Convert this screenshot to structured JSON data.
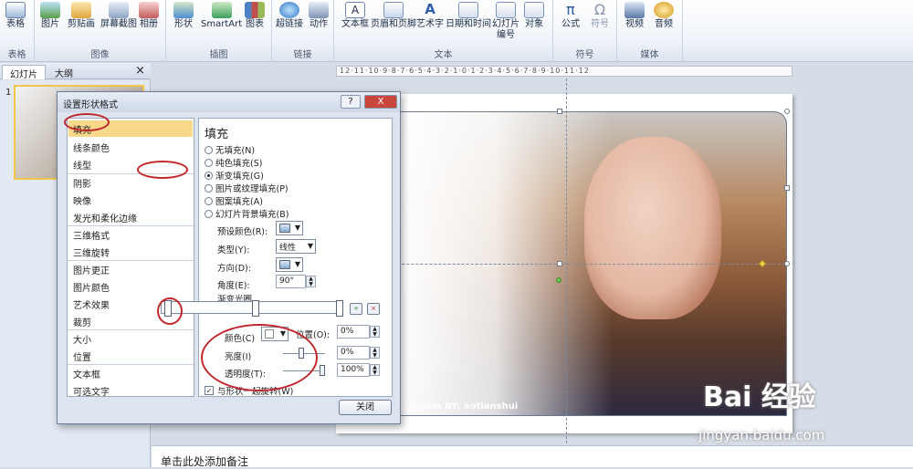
{
  "ribbon": {
    "groups": [
      {
        "label": "表格",
        "buttons": [
          "表格"
        ]
      },
      {
        "label": "图像",
        "buttons": [
          "图片",
          "剪贴画",
          "屏幕截图",
          "相册"
        ]
      },
      {
        "label": "插图",
        "buttons": [
          "形状",
          "SmartArt",
          "图表"
        ]
      },
      {
        "label": "链接",
        "buttons": [
          "超链接",
          "动作"
        ]
      },
      {
        "label": "文本",
        "buttons": [
          "文本框",
          "页眉和页脚",
          "艺术字",
          "日期和时间",
          "幻灯片编号",
          "对象"
        ]
      },
      {
        "label": "符号",
        "buttons": [
          "公式",
          "符号"
        ]
      },
      {
        "label": "媒体",
        "buttons": [
          "视频",
          "音频"
        ]
      }
    ]
  },
  "left_panel": {
    "tabs": [
      "幻灯片",
      "大纲"
    ],
    "close": "×",
    "slide_number": "1"
  },
  "ruler": {
    "text": "12·11·10·9·8·7·6·5·4·3·2·1·0·1·2·3·4·5·6·7·8·9·10·11·12"
  },
  "slide": {
    "watermark": "pic.com   BY: aotianshui",
    "baidu_logo": "Bai 经验",
    "baidu_url": "jingyan.baidu.com"
  },
  "notes": {
    "placeholder": "单击此处添加备注"
  },
  "dialog": {
    "title": "设置形状格式",
    "help": "?",
    "close": "X",
    "nav": [
      "填充",
      "线条颜色",
      "线型",
      "阴影",
      "映像",
      "发光和柔化边缘",
      "三维格式",
      "三维旋转",
      "图片更正",
      "图片颜色",
      "艺术效果",
      "裁剪",
      "大小",
      "位置",
      "文本框",
      "可选文字"
    ],
    "fill": {
      "heading": "填充",
      "options": [
        "无填充(N)",
        "纯色填充(S)",
        "渐变填充(G)",
        "图片或纹理填充(P)",
        "图案填充(A)",
        "幻灯片背景填充(B)"
      ],
      "selected_index": 2,
      "preset_label": "预设颜色(R):",
      "type_label": "类型(Y):",
      "type_value": "线性",
      "direction_label": "方向(D):",
      "angle_label": "角度(E):",
      "angle_value": "90°",
      "stops_label": "渐变光圈",
      "color_label": "颜色(C)",
      "position_label": "位置(O):",
      "position_value": "0%",
      "brightness_label": "亮度(I)",
      "brightness_value": "0%",
      "transparency_label": "透明度(T):",
      "transparency_value": "100%",
      "transparency_level": 1.0,
      "rotate_label": "与形状一起旋转(W)",
      "rotate_checked": true
    },
    "close_button": "关闭"
  }
}
